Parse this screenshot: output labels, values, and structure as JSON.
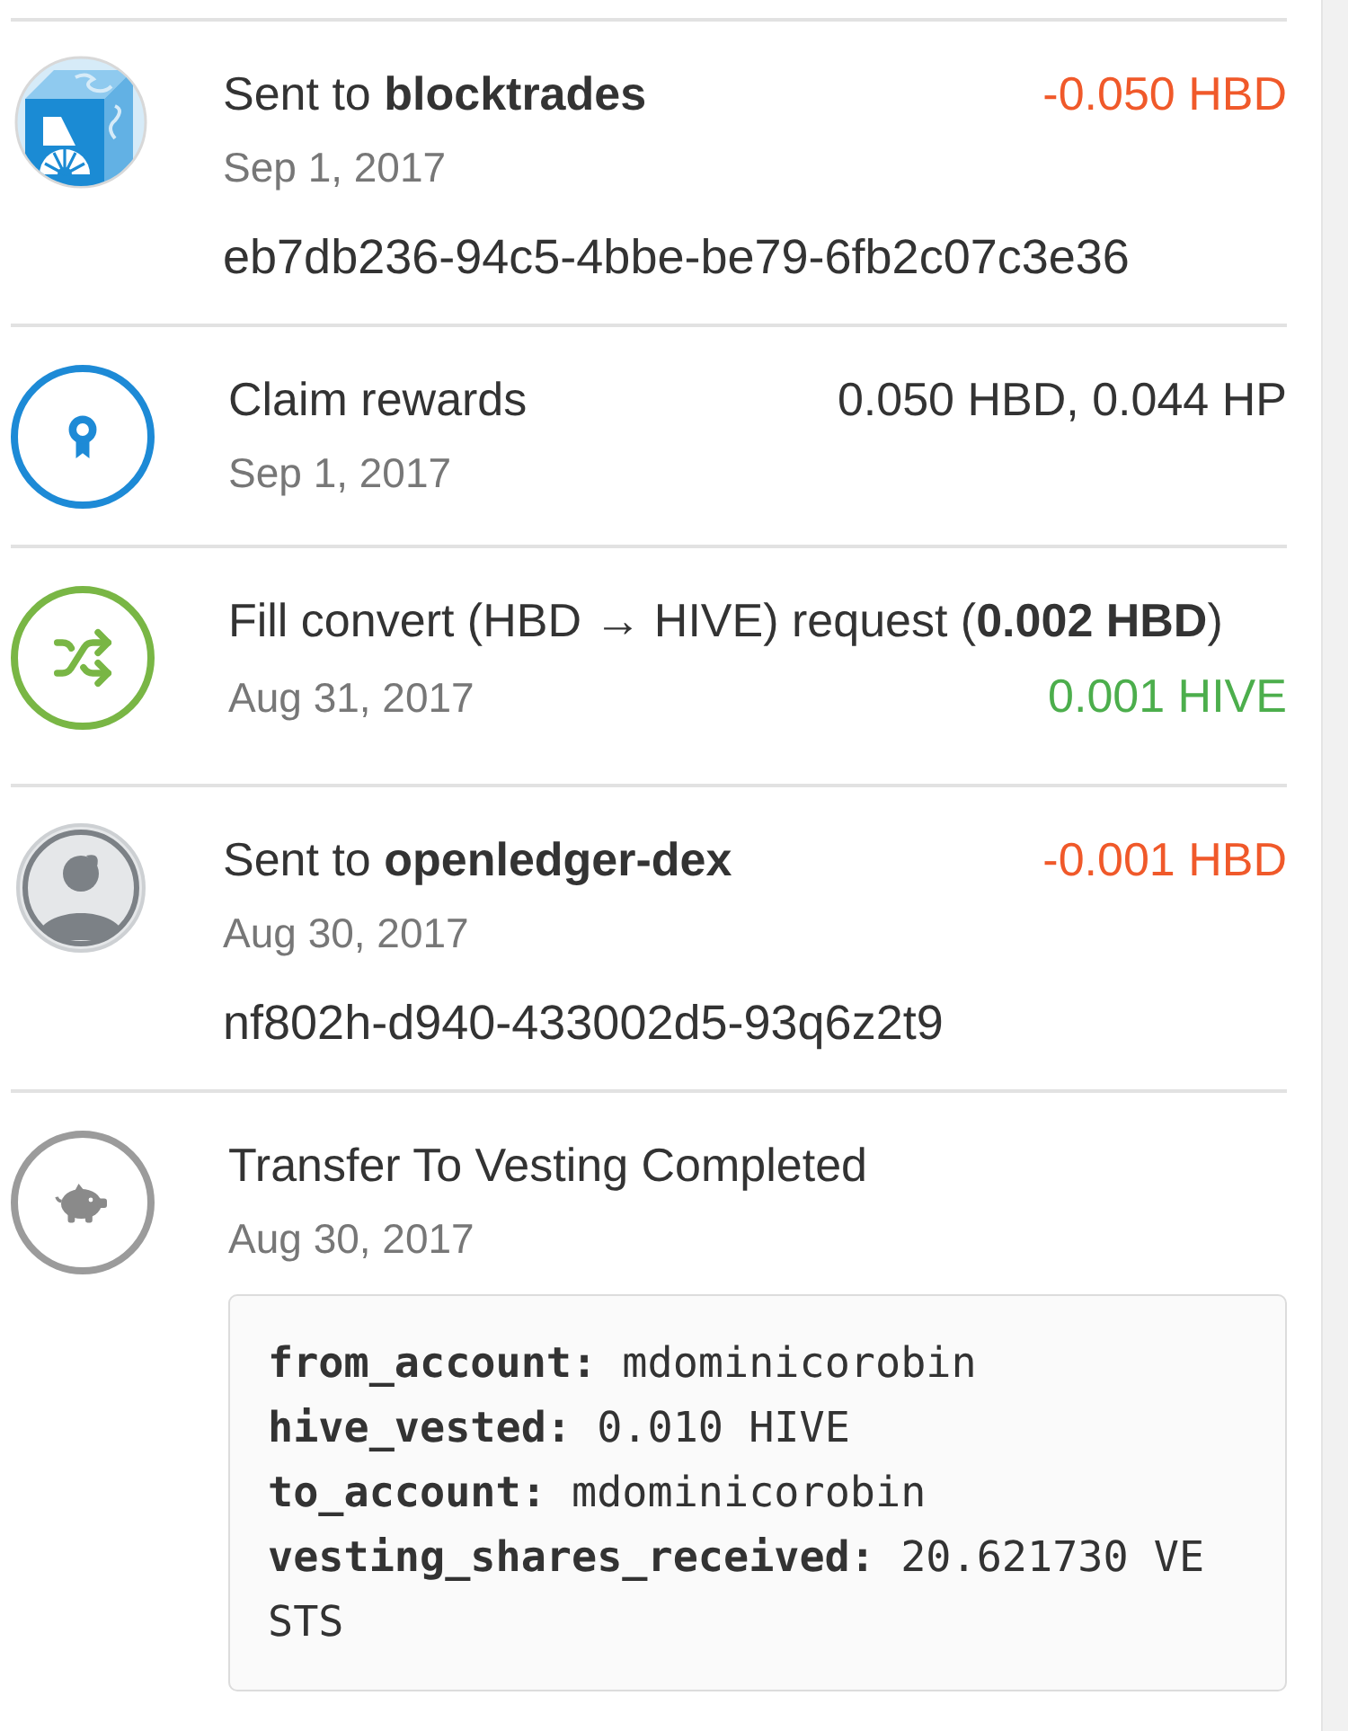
{
  "transactions": [
    {
      "kind": "transfer",
      "profile_picture": true,
      "title": "Sent to **blocktrades**",
      "date": "Sep 1, 2017",
      "amount": "-0.050 HBD",
      "memo": "eb7db236-94c5-4bbe-be79-6fb2c07c3e36"
    },
    {
      "kind": "claim",
      "title": "Claim rewards",
      "date": "Sep 1, 2017",
      "amount": "0.050 HBD, 0.044 HP"
    },
    {
      "kind": "convert",
      "title": "Fill convert (HBD → HIVE) request (**0.002 HBD**)",
      "date": "Aug 31, 2017",
      "amount": "0.001 HIVE"
    },
    {
      "kind": "transfer",
      "profile_picture": false,
      "title": "Sent to **openledger-dex**",
      "date": "Aug 30, 2017",
      "amount": "-0.001 HBD",
      "memo": "nf802h-d940-433002d5-93q6z2t9"
    },
    {
      "kind": "vesting",
      "title": "Transfer To Vesting Completed",
      "date": "Aug 30, 2017",
      "details": [
        {
          "key": "from_account:",
          "value": "mdominicorobin"
        },
        {
          "key": "hive_vested:",
          "value": "0.010 HIVE"
        },
        {
          "key": "to_account:",
          "value": "mdominicorobin"
        },
        {
          "key": "vesting_shares_received:",
          "value": "20.621730 VESTS"
        }
      ]
    }
  ]
}
